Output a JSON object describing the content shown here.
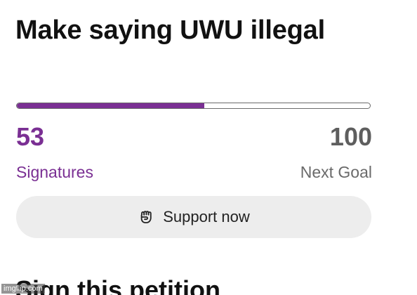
{
  "petition": {
    "title": "Make saying UWU illegal"
  },
  "progress": {
    "signatures": "53",
    "signatures_label": "Signatures",
    "goal": "100",
    "goal_label": "Next Goal",
    "fraction": 0.53,
    "accent_color": "#7a2f93"
  },
  "support": {
    "icon": "fist-icon",
    "label": "Support now"
  },
  "sign_section": {
    "heading": "Sign this petition"
  },
  "watermark": {
    "text": "imgflip.com"
  }
}
